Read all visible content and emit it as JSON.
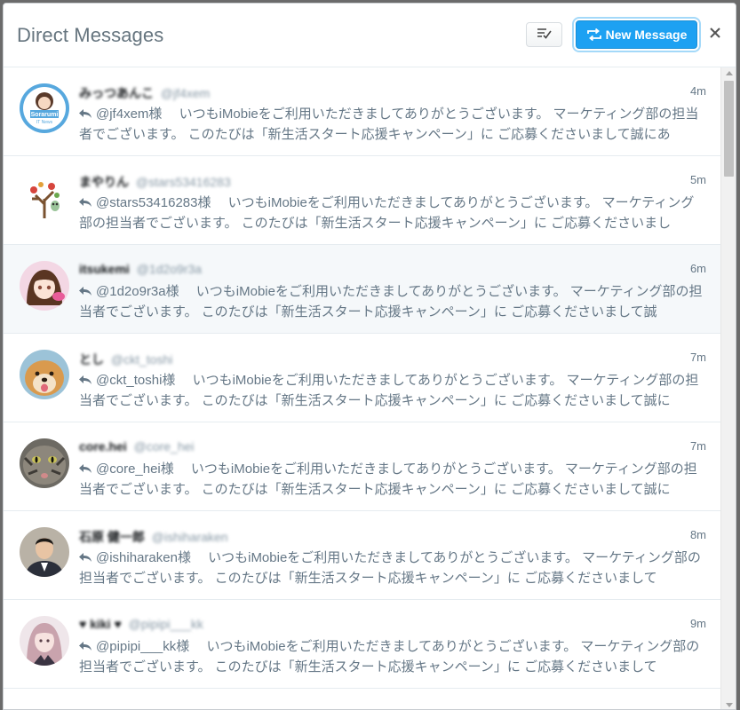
{
  "header": {
    "title": "Direct Messages",
    "mark_read_icon": "mark-all-read-icon",
    "new_message_label": "New Message",
    "new_message_icon": "new-message-icon",
    "close_icon": "close-icon"
  },
  "colors": {
    "accent": "#1da1f2",
    "row_highlight": "#f5f8fa",
    "text_secondary": "#657786"
  },
  "conversations": [
    {
      "name": "みっつあんこ",
      "handle": "@jf4xem",
      "time": "4m",
      "avatar": "sorarumi-news-avatar",
      "preview": "@jf4xem様　 いつもiMobieをご利用いただきましてありがとうございます。 マーケティング部の担当者でございます。 このたびは「新生活スタート応援キャンペーン」に ご応募くださいまして誠にあ"
    },
    {
      "name": "まやりん",
      "handle": "@stars53416283",
      "time": "5m",
      "avatar": "tree-owl-avatar",
      "preview": "@stars53416283様　 いつもiMobieをご利用いただきましてありがとうございます。 マーケティング部の担当者でございます。 このたびは「新生活スタート応援キャンペーン」に ご応募くださいまし"
    },
    {
      "name": "itsukemi",
      "handle": "@1d2o9r3a",
      "time": "6m",
      "avatar": "anime-girl-avatar",
      "preview": "@1d2o9r3a様　 いつもiMobieをご利用いただきましてありがとうございます。 マーケティング部の担当者でございます。 このたびは「新生活スタート応援キャンペーン」に ご応募くださいまして誠"
    },
    {
      "name": "とし",
      "handle": "@ckt_toshi",
      "time": "7m",
      "avatar": "shiba-dog-avatar",
      "preview": "@ckt_toshi様　 いつもiMobieをご利用いただきましてありがとうございます。 マーケティング部の担当者でございます。 このたびは「新生活スタート応援キャンペーン」に ご応募くださいまして誠に"
    },
    {
      "name": "core.hei",
      "handle": "@core_hei",
      "time": "7m",
      "avatar": "cat-avatar",
      "preview": "@core_hei様　 いつもiMobieをご利用いただきましてありがとうございます。 マーケティング部の担当者でございます。 このたびは「新生活スタート応援キャンペーン」に ご応募くださいまして誠に"
    },
    {
      "name": "石原 健一郎",
      "handle": "@ishiharaken",
      "time": "8m",
      "avatar": "man-portrait-avatar",
      "preview": "@ishiharaken様　 いつもiMobieをご利用いただきましてありがとうございます。 マーケティング部の担当者でございます。 このたびは「新生活スタート応援キャンペーン」に ご応募くださいまして"
    },
    {
      "name": "♥ kiki ♥",
      "handle": "@pipipi___kk",
      "time": "9m",
      "avatar": "girl-portrait-avatar",
      "preview": "@pipipi___kk様　 いつもiMobieをご利用いただきましてありがとうございます。 マーケティング部の担当者でございます。 このたびは「新生活スタート応援キャンペーン」に ご応募くださいまして"
    }
  ]
}
